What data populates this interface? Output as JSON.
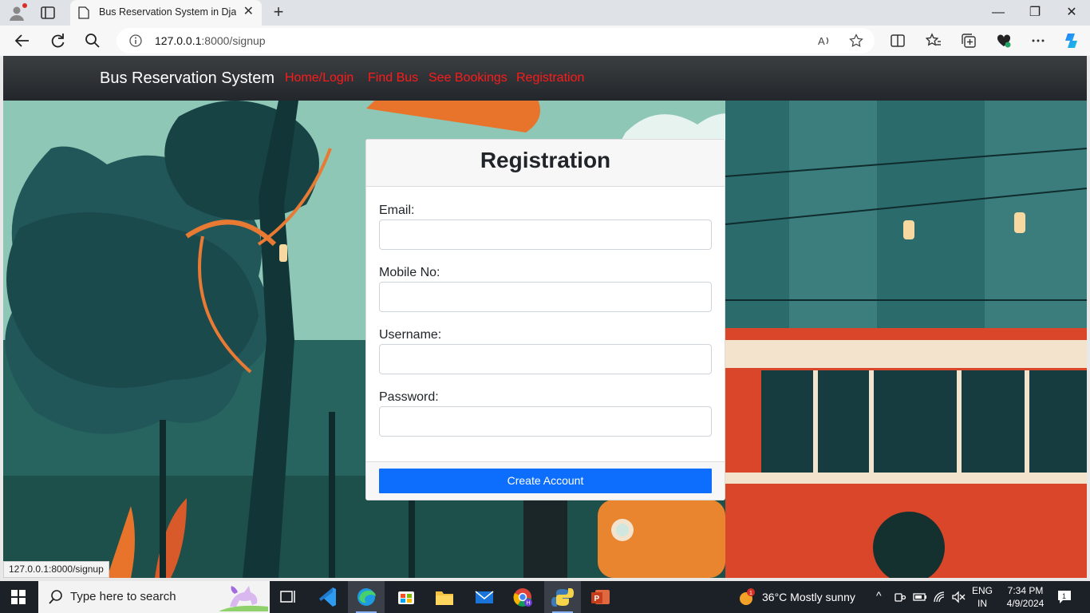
{
  "browser": {
    "tab_title": "Bus Reservation System in Django",
    "url_host": "127.0.0.1",
    "url_rest": ":8000/signup",
    "status_url": "127.0.0.1:8000/signup"
  },
  "navbar": {
    "brand": "Bus Reservation System",
    "links": [
      {
        "label": "Home/Login"
      },
      {
        "label": "Find Bus"
      },
      {
        "label": "See Bookings"
      },
      {
        "label": "Registration"
      }
    ],
    "link_color": "#ff1a1a"
  },
  "form": {
    "title": "Registration",
    "fields": [
      {
        "label": "Email:",
        "value": ""
      },
      {
        "label": "Mobile No:",
        "value": ""
      },
      {
        "label": "Username:",
        "value": ""
      },
      {
        "label": "Password:",
        "value": ""
      }
    ],
    "submit_label": "Create Account",
    "accent": "#0d6efd"
  },
  "taskbar": {
    "search_placeholder": "Type here to search",
    "weather": "36°C  Mostly sunny",
    "weather_badge": "1",
    "lang_top": "ENG",
    "lang_bottom": "IN",
    "time": "7:34 PM",
    "date": "4/9/2024",
    "notification_count": "1"
  }
}
